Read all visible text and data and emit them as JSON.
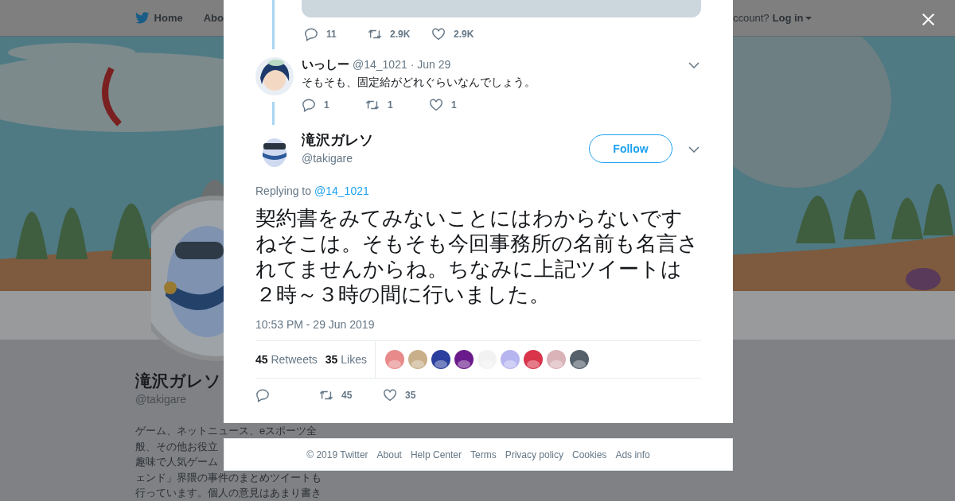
{
  "header": {
    "nav": [
      {
        "label": "Home",
        "kind": "home"
      },
      {
        "label": "Abo",
        "kind": "plain"
      }
    ],
    "account_prompt": "ccount?",
    "login": "Log in"
  },
  "profile": {
    "name": "滝沢ガレソ",
    "handle": "@takigare",
    "bio_lines": [
      "ゲーム、ネットニュース、eスポーツ全",
      "般、その他お役立",
      "趣味で人気ゲーム",
      "ェンド」界隈の事件のまとめツイートも",
      "行っています。個人の意見はあまり書き"
    ]
  },
  "modal": {
    "quoted_actions": [
      {
        "kind": "reply",
        "count": "11"
      },
      {
        "kind": "retweet",
        "count": "2.9K"
      },
      {
        "kind": "like",
        "count": "2.9K"
      }
    ],
    "reply": {
      "name": "いっしー",
      "handle": "@14_1021",
      "date": "· Jun 29",
      "text": "そもそも、固定給がどれぐらいなんでしょう。",
      "actions": [
        {
          "kind": "reply",
          "count": "1"
        },
        {
          "kind": "retweet",
          "count": "1"
        },
        {
          "kind": "like",
          "count": "1"
        }
      ]
    },
    "tweet": {
      "name": "滝沢ガレソ",
      "handle": "@takigare",
      "follow": "Follow",
      "replying_label": "Replying to",
      "replying_to": "@14_1021",
      "text": "契約書をみてみないことにはわからないですねそこは。そもそも今回事務所の名前も名言されてませんからね。ちなみに上記ツイートは２時～３時の間に行いました。",
      "timestamp": "10:53 PM - 29 Jun 2019",
      "retweets": {
        "count": "45",
        "label": "Retweets"
      },
      "likes": {
        "count": "35",
        "label": "Likes"
      },
      "actions": [
        {
          "kind": "reply"
        },
        {
          "kind": "retweet",
          "count": "45"
        },
        {
          "kind": "like",
          "count": "35"
        }
      ]
    }
  },
  "footer": [
    "© 2019 Twitter",
    "About",
    "Help Center",
    "Terms",
    "Privacy policy",
    "Cookies",
    "Ads info"
  ]
}
